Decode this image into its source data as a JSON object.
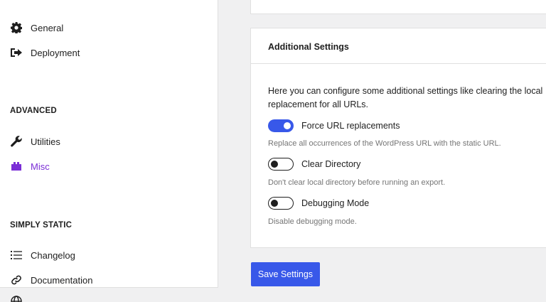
{
  "sidebar": {
    "items_top": [
      {
        "label": "General",
        "icon": "gear-icon"
      },
      {
        "label": "Deployment",
        "icon": "sign-out-icon"
      }
    ],
    "advanced": {
      "title": "ADVANCED",
      "items": [
        {
          "label": "Utilities",
          "icon": "wrench-icon"
        },
        {
          "label": "Misc",
          "icon": "plugin-block-icon",
          "active": true
        }
      ]
    },
    "simply_static": {
      "title": "SIMPLY STATIC",
      "items": [
        {
          "label": "Changelog",
          "icon": "list-icon"
        },
        {
          "label": "Documentation",
          "icon": "link-icon"
        },
        {
          "label": "",
          "icon": "globe-icon"
        }
      ]
    }
  },
  "card": {
    "title": "Additional Settings",
    "description_line1": "Here you can configure some additional settings like clearing the local",
    "description_line2": "replacement for all URLs.",
    "settings": [
      {
        "label": "Force URL replacements",
        "enabled": true,
        "help": "Replace all occurrences of the WordPress URL with the static URL."
      },
      {
        "label": "Clear Directory",
        "enabled": false,
        "help": "Don't clear local directory before running an export."
      },
      {
        "label": "Debugging Mode",
        "enabled": false,
        "help": "Disable debugging mode."
      }
    ]
  },
  "save_button": {
    "label": "Save Settings"
  },
  "colors": {
    "accent": "#3858e9",
    "active_nav": "#7b2ed6",
    "background": "#f0f0f1"
  }
}
